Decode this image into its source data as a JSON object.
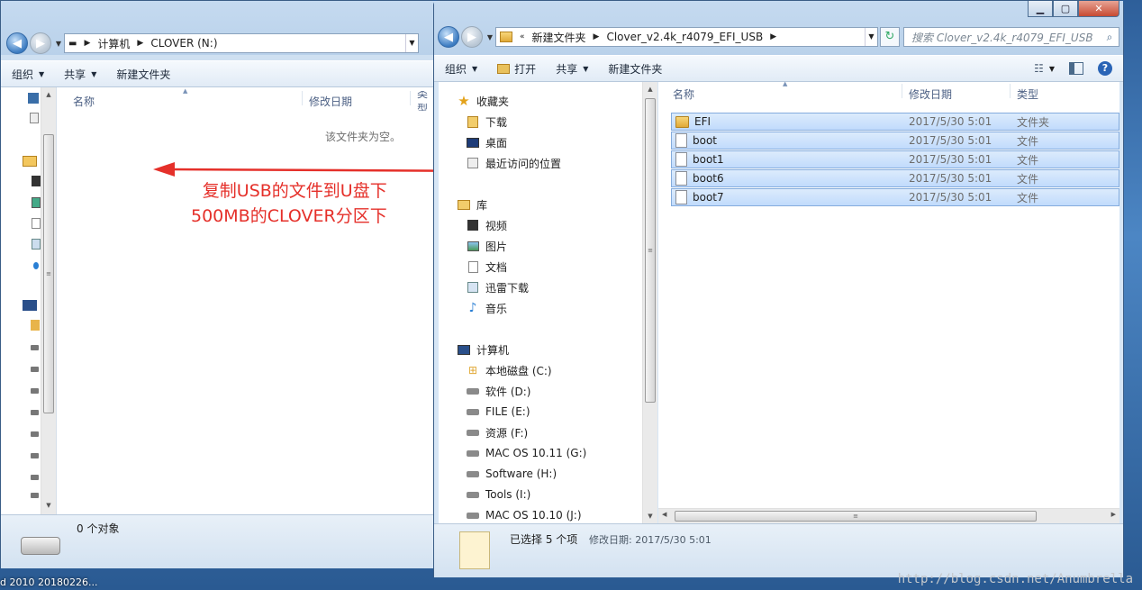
{
  "taskbar": {
    "text": "d 2010   20180226..."
  },
  "left_window": {
    "address": {
      "root": "计算机",
      "location": "CLOVER (N:)"
    },
    "toolbar": {
      "organize": "组织",
      "share": "共享",
      "new_folder": "新建文件夹"
    },
    "columns": {
      "name": "名称",
      "date": "修改日期",
      "type": "类型"
    },
    "empty_text": "该文件夹为空。",
    "status_text": "0 个对象"
  },
  "right_window": {
    "address": {
      "prefix": "«",
      "parent": "新建文件夹",
      "location": "Clover_v2.4k_r4079_EFI_USB"
    },
    "search": {
      "placeholder": "搜索 Clover_v2.4k_r4079_EFI_USB"
    },
    "toolbar": {
      "organize": "组织",
      "open": "打开",
      "share": "共享",
      "new_folder": "新建文件夹"
    },
    "nav": {
      "favorites": {
        "label": "收藏夹",
        "items": [
          "下载",
          "桌面",
          "最近访问的位置"
        ]
      },
      "libraries": {
        "label": "库",
        "items": [
          "视频",
          "图片",
          "文档",
          "迅雷下载",
          "音乐"
        ]
      },
      "computer": {
        "label": "计算机",
        "items": [
          "本地磁盘 (C:)",
          "软件 (D:)",
          "FILE (E:)",
          "资源 (F:)",
          "MAC OS 10.11 (G:)",
          "Software (H:)",
          "Tools (I:)",
          "MAC OS 10.10 (J:)"
        ]
      }
    },
    "columns": {
      "name": "名称",
      "date": "修改日期",
      "type": "类型"
    },
    "files": [
      {
        "name": "EFI",
        "date": "2017/5/30 5:01",
        "type": "文件夹",
        "kind": "folder"
      },
      {
        "name": "boot",
        "date": "2017/5/30 5:01",
        "type": "文件",
        "kind": "file"
      },
      {
        "name": "boot1",
        "date": "2017/5/30 5:01",
        "type": "文件",
        "kind": "file"
      },
      {
        "name": "boot6",
        "date": "2017/5/30 5:01",
        "type": "文件",
        "kind": "file"
      },
      {
        "name": "boot7",
        "date": "2017/5/30 5:01",
        "type": "文件",
        "kind": "file"
      }
    ],
    "status": {
      "selected": "已选择 5 个项",
      "modified": "修改日期: 2017/5/30 5:01"
    }
  },
  "annotation": {
    "line1": "复制USB的文件到U盘下",
    "line2": "500MB的CLOVER分区下",
    "color": "#e5302a"
  },
  "watermark": "http://blog.csdn.net/Anumbrella"
}
